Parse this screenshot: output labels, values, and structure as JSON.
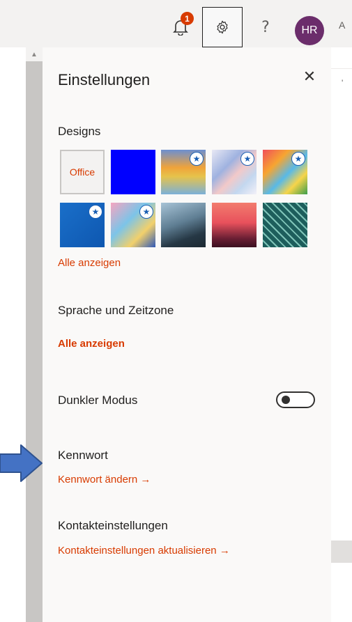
{
  "header": {
    "notifications_count": "1",
    "help_label": "?",
    "avatar_initials": "HR",
    "edge_letter": "A"
  },
  "panel": {
    "title": "Einstellungen",
    "designs": {
      "heading": "Designs",
      "office_label": "Office",
      "show_all": "Alle anzeigen"
    },
    "language": {
      "heading": "Sprache und Zeitzone",
      "show_all": "Alle anzeigen"
    },
    "dark_mode": {
      "heading": "Dunkler Modus",
      "enabled": false
    },
    "password": {
      "heading": "Kennwort",
      "link": "Kennwort ändern →"
    },
    "contacts": {
      "heading": "Kontakteinstellungen",
      "link": "Kontakteinstellungen aktualisieren →"
    }
  },
  "colors": {
    "accent": "#d83b01",
    "avatar_bg": "#6b2d6b",
    "arrow": "#4472c4"
  }
}
